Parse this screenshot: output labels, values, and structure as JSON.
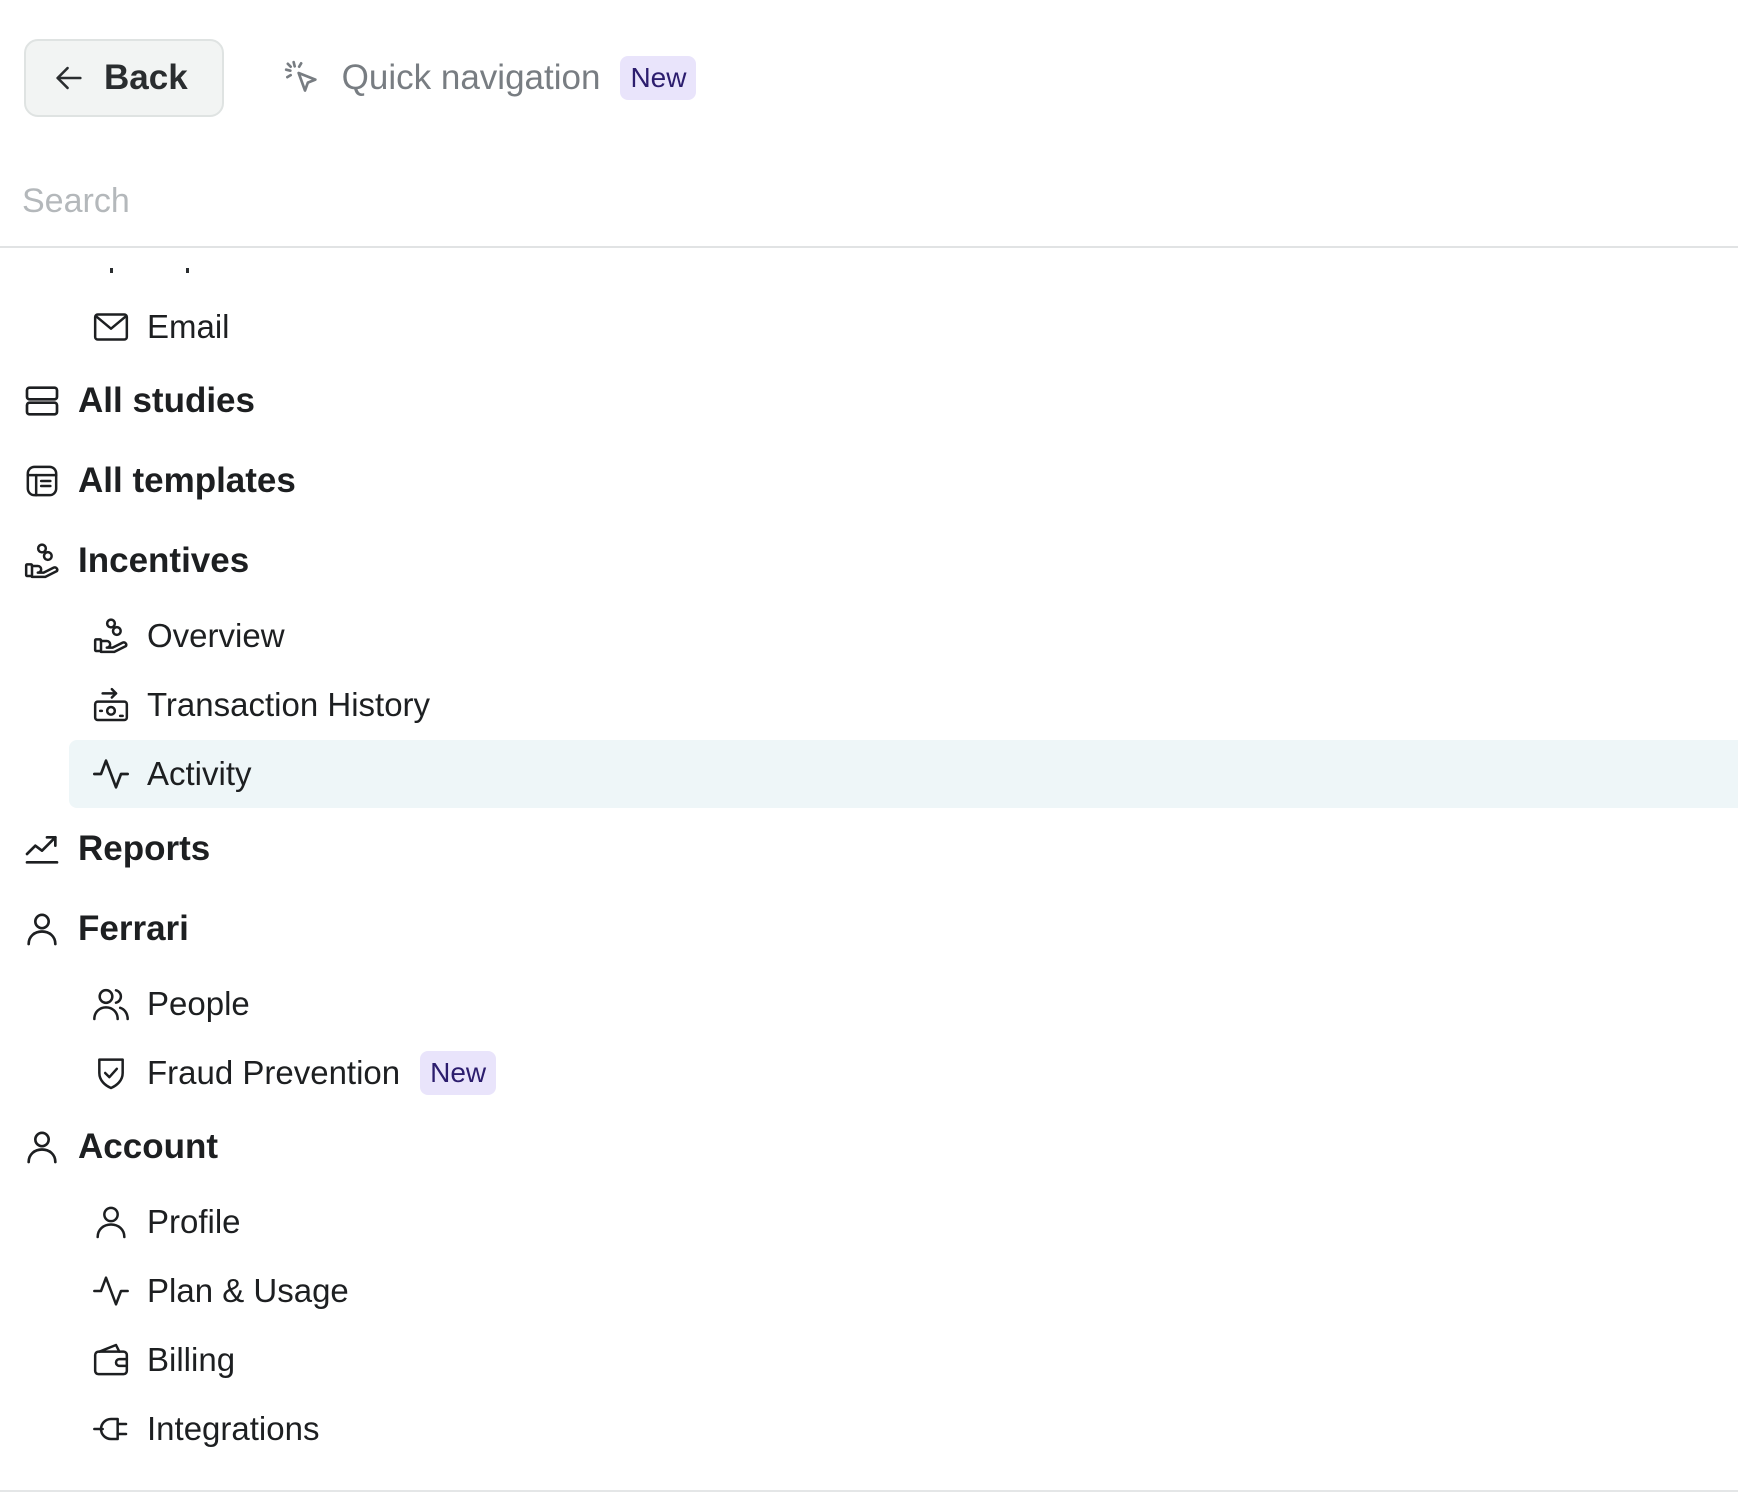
{
  "header": {
    "back_label": "Back",
    "quick_nav_label": "Quick navigation",
    "quick_nav_badge": "New"
  },
  "search": {
    "placeholder": "Search",
    "value": ""
  },
  "nav": {
    "email": "Email",
    "all_studies": "All studies",
    "all_templates": "All templates",
    "incentives": {
      "label": "Incentives",
      "overview": "Overview",
      "transaction_history": "Transaction History",
      "activity": "Activity"
    },
    "reports": "Reports",
    "ferrari": {
      "label": "Ferrari",
      "people": "People",
      "fraud_prevention": "Fraud Prevention",
      "fraud_badge": "New"
    },
    "account": {
      "label": "Account",
      "profile": "Profile",
      "plan_usage": "Plan & Usage",
      "billing": "Billing",
      "integrations": "Integrations"
    }
  },
  "colors": {
    "active_row_bg": "#eef6f8",
    "badge_bg": "#e9e4fb",
    "badge_text": "#2c1d6e",
    "back_button_bg": "#f2f4f3"
  }
}
